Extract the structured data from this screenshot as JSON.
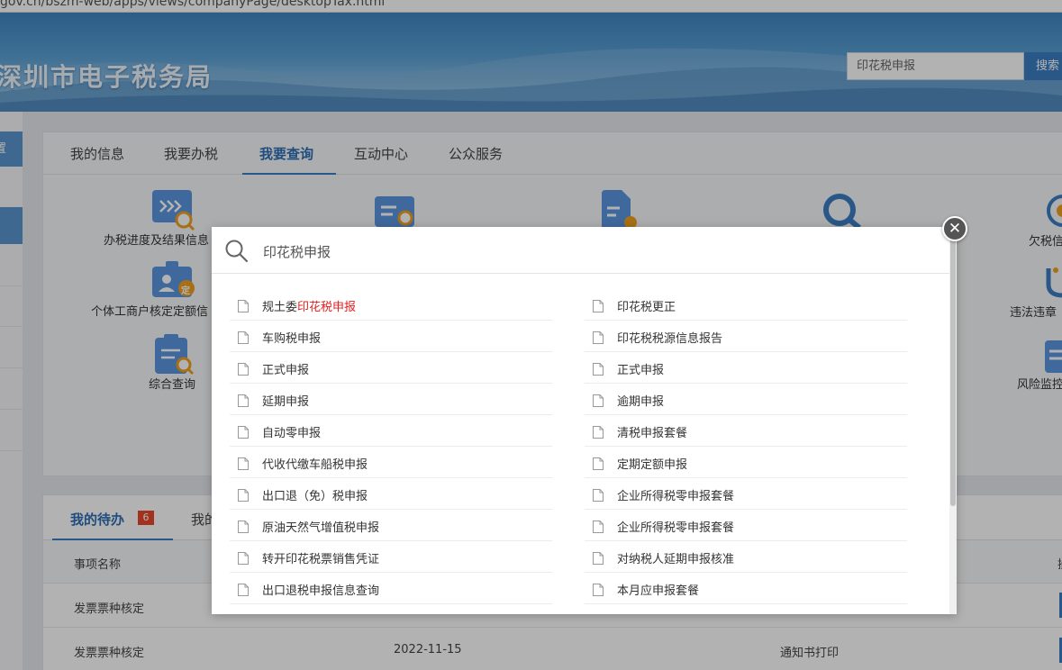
{
  "browser": {
    "url": "gov.cn/bszm-web/apps/views/companyPage/desktopTax.html"
  },
  "header": {
    "site_title": "深圳市电子税务局",
    "search_value": "印花税申报",
    "search_button": "搜索"
  },
  "sidebar": {
    "first_tab": "置"
  },
  "nav": {
    "tabs": [
      {
        "label": "我的信息"
      },
      {
        "label": "我要办税"
      },
      {
        "label": "我要查询",
        "active": true
      },
      {
        "label": "互动中心"
      },
      {
        "label": "公众服务"
      }
    ]
  },
  "services": {
    "progress": "办税进度及结果信息",
    "individual": "个体工商户核定定额信",
    "comprehensive": "综合查询",
    "arrears": "欠税信",
    "violation": "违法违章",
    "risk": "风险监控",
    "badge_char": "定"
  },
  "todo": {
    "tab_label": "我的待办",
    "badge_count": "6",
    "tab2_label": "我的",
    "col_name": "事项名称",
    "col_op": "操",
    "rows": [
      {
        "name": "发票票种核定",
        "date": "",
        "action": ""
      },
      {
        "name": "发票票种核定",
        "date": "2022-11-15",
        "action": "通知书打印"
      }
    ]
  },
  "modal": {
    "search_text": "印花税申报",
    "left_items": [
      {
        "prefix": "规土委",
        "highlight": "印花税申报"
      },
      {
        "prefix": "车购税申报",
        "highlight": ""
      },
      {
        "prefix": "正式申报",
        "highlight": ""
      },
      {
        "prefix": "延期申报",
        "highlight": ""
      },
      {
        "prefix": "自动零申报",
        "highlight": ""
      },
      {
        "prefix": "代收代缴车船税申报",
        "highlight": ""
      },
      {
        "prefix": "出口退（免）税申报",
        "highlight": ""
      },
      {
        "prefix": "原油天然气增值税申报",
        "highlight": ""
      },
      {
        "prefix": "转开印花税票销售凭证",
        "highlight": ""
      },
      {
        "prefix": "出口退税申报信息查询",
        "highlight": ""
      }
    ],
    "right_items": [
      {
        "prefix": "印花税更正",
        "highlight": ""
      },
      {
        "prefix": "印花税税源信息报告",
        "highlight": ""
      },
      {
        "prefix": "正式申报",
        "highlight": ""
      },
      {
        "prefix": "逾期申报",
        "highlight": ""
      },
      {
        "prefix": "清税申报套餐",
        "highlight": ""
      },
      {
        "prefix": "定期定额申报",
        "highlight": ""
      },
      {
        "prefix": "企业所得税零申报套餐",
        "highlight": ""
      },
      {
        "prefix": "企业所得税零申报套餐",
        "highlight": ""
      },
      {
        "prefix": "对纳税人延期申报核准",
        "highlight": ""
      },
      {
        "prefix": "本月应申报套餐",
        "highlight": ""
      }
    ],
    "close_glyph": "✕"
  },
  "colors": {
    "accent": "#3c7fc3",
    "highlight": "#e02020",
    "badge": "#e8482b"
  },
  "icons": [
    "search-icon",
    "document-icon",
    "close-icon"
  ]
}
